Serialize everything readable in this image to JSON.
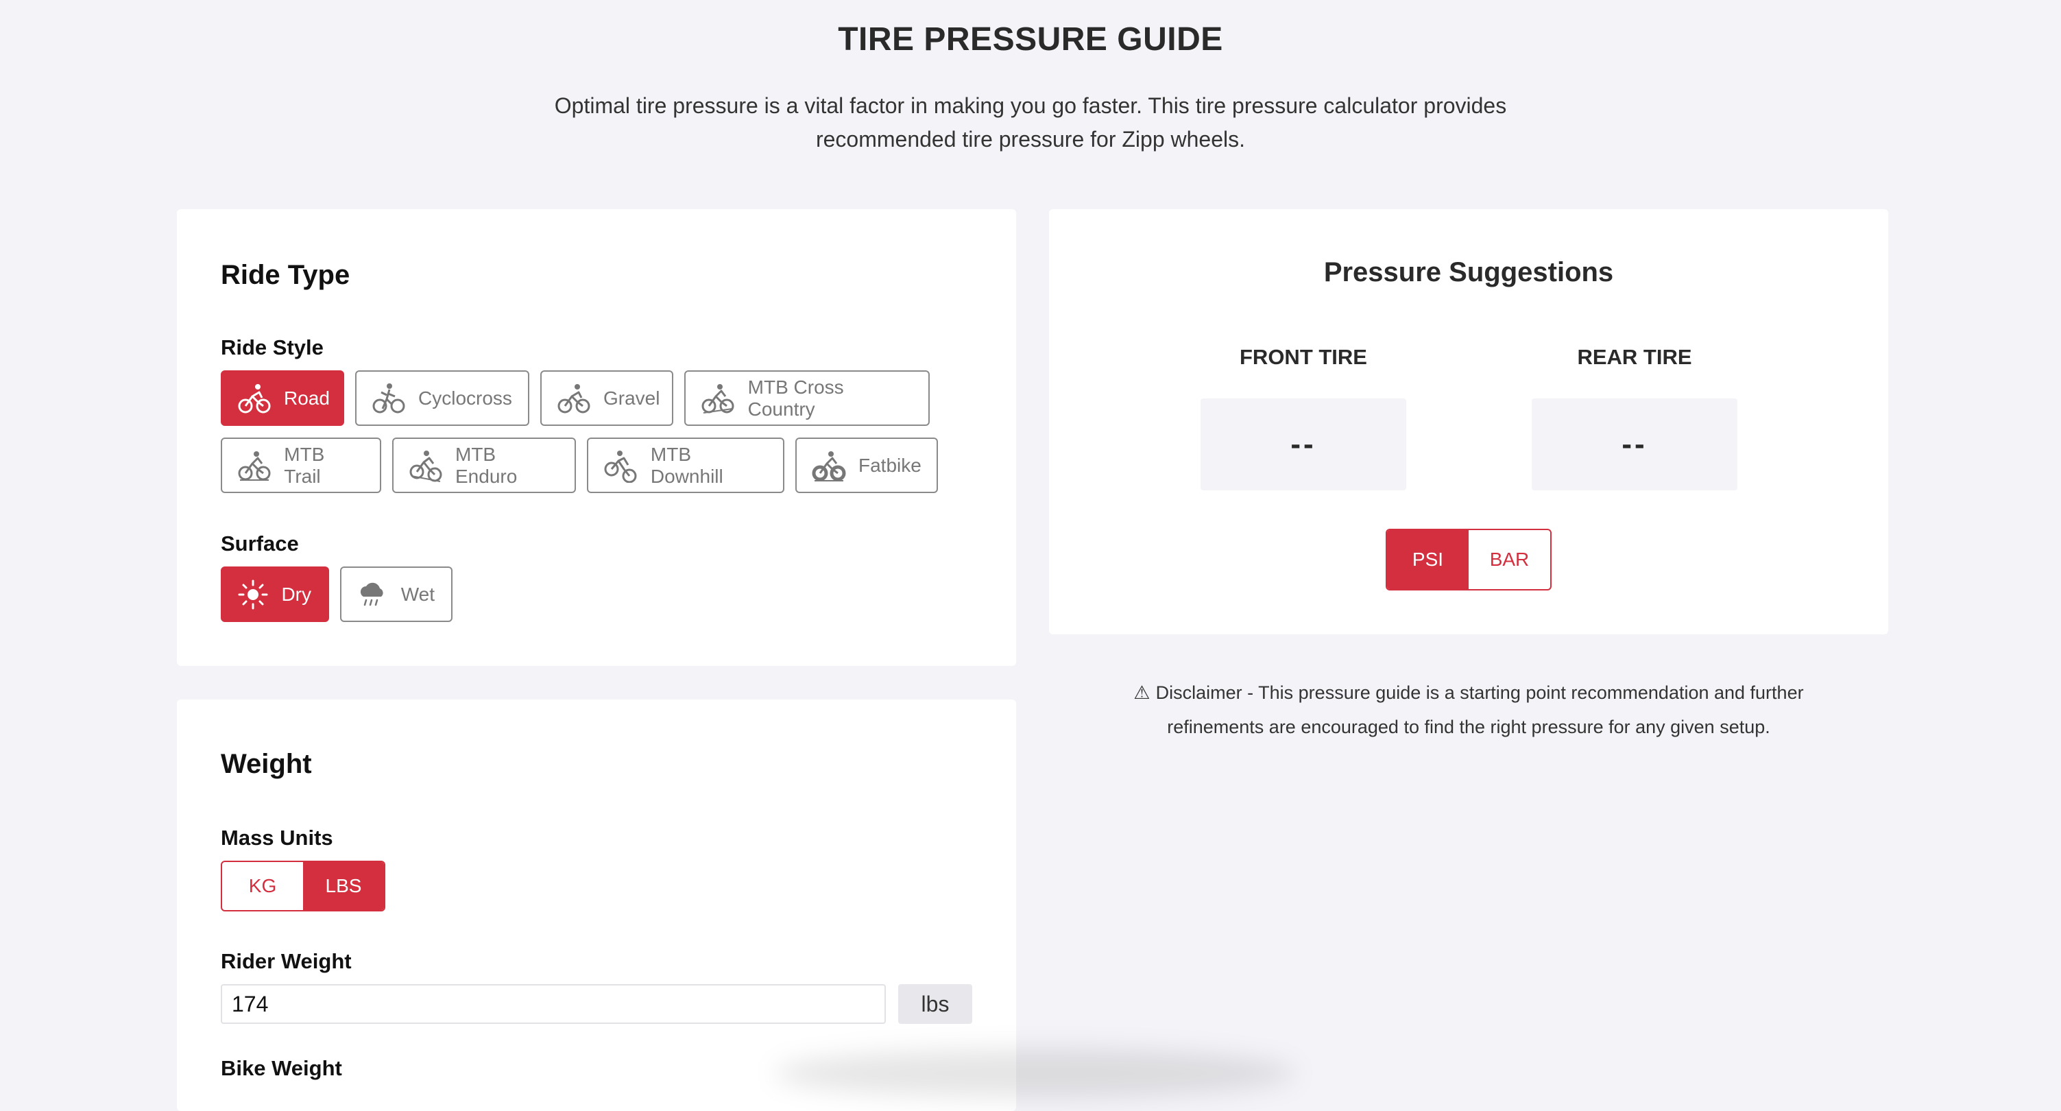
{
  "header": {
    "title": "TIRE PRESSURE GUIDE",
    "intro": "Optimal tire pressure is a vital factor in making you go faster. This tire pressure calculator provides recommended tire pressure for Zipp wheels."
  },
  "ride_type": {
    "title": "Ride Type",
    "style_label": "Ride Style",
    "styles": [
      {
        "label": "Road",
        "icon": "road-bike-icon",
        "selected": true
      },
      {
        "label": "Cyclocross",
        "icon": "cyclocross-icon",
        "selected": false
      },
      {
        "label": "Gravel",
        "icon": "gravel-bike-icon",
        "selected": false
      },
      {
        "label": "MTB Cross Country",
        "icon": "mtb-cross-country-icon",
        "selected": false
      },
      {
        "label": "MTB Trail",
        "icon": "mtb-trail-icon",
        "selected": false
      },
      {
        "label": "MTB Enduro",
        "icon": "mtb-enduro-icon",
        "selected": false
      },
      {
        "label": "MTB Downhill",
        "icon": "mtb-downhill-icon",
        "selected": false
      },
      {
        "label": "Fatbike",
        "icon": "fatbike-icon",
        "selected": false
      }
    ],
    "surface_label": "Surface",
    "surfaces": [
      {
        "label": "Dry",
        "icon": "sun-icon",
        "selected": true
      },
      {
        "label": "Wet",
        "icon": "rain-cloud-icon",
        "selected": false
      }
    ]
  },
  "weight": {
    "title": "Weight",
    "mass_units_label": "Mass Units",
    "mass_units": [
      {
        "label": "KG",
        "selected": false
      },
      {
        "label": "LBS",
        "selected": true
      }
    ],
    "rider_weight_label": "Rider Weight",
    "rider_weight_value": "174",
    "rider_weight_unit": "lbs",
    "bike_weight_label": "Bike Weight"
  },
  "pressure": {
    "title": "Pressure Suggestions",
    "front_label": "FRONT TIRE",
    "front_value": "--",
    "rear_label": "REAR TIRE",
    "rear_value": "--",
    "units": [
      {
        "label": "PSI",
        "selected": true
      },
      {
        "label": "BAR",
        "selected": false
      }
    ]
  },
  "disclaimer": {
    "icon": "warning-icon",
    "text": "Disclaimer - This pressure guide is a starting point recommendation and further refinements are encouraged to find the right pressure for any given setup."
  },
  "colors": {
    "accent": "#d32f3f",
    "background": "#f4f4f8",
    "card": "#ffffff"
  }
}
